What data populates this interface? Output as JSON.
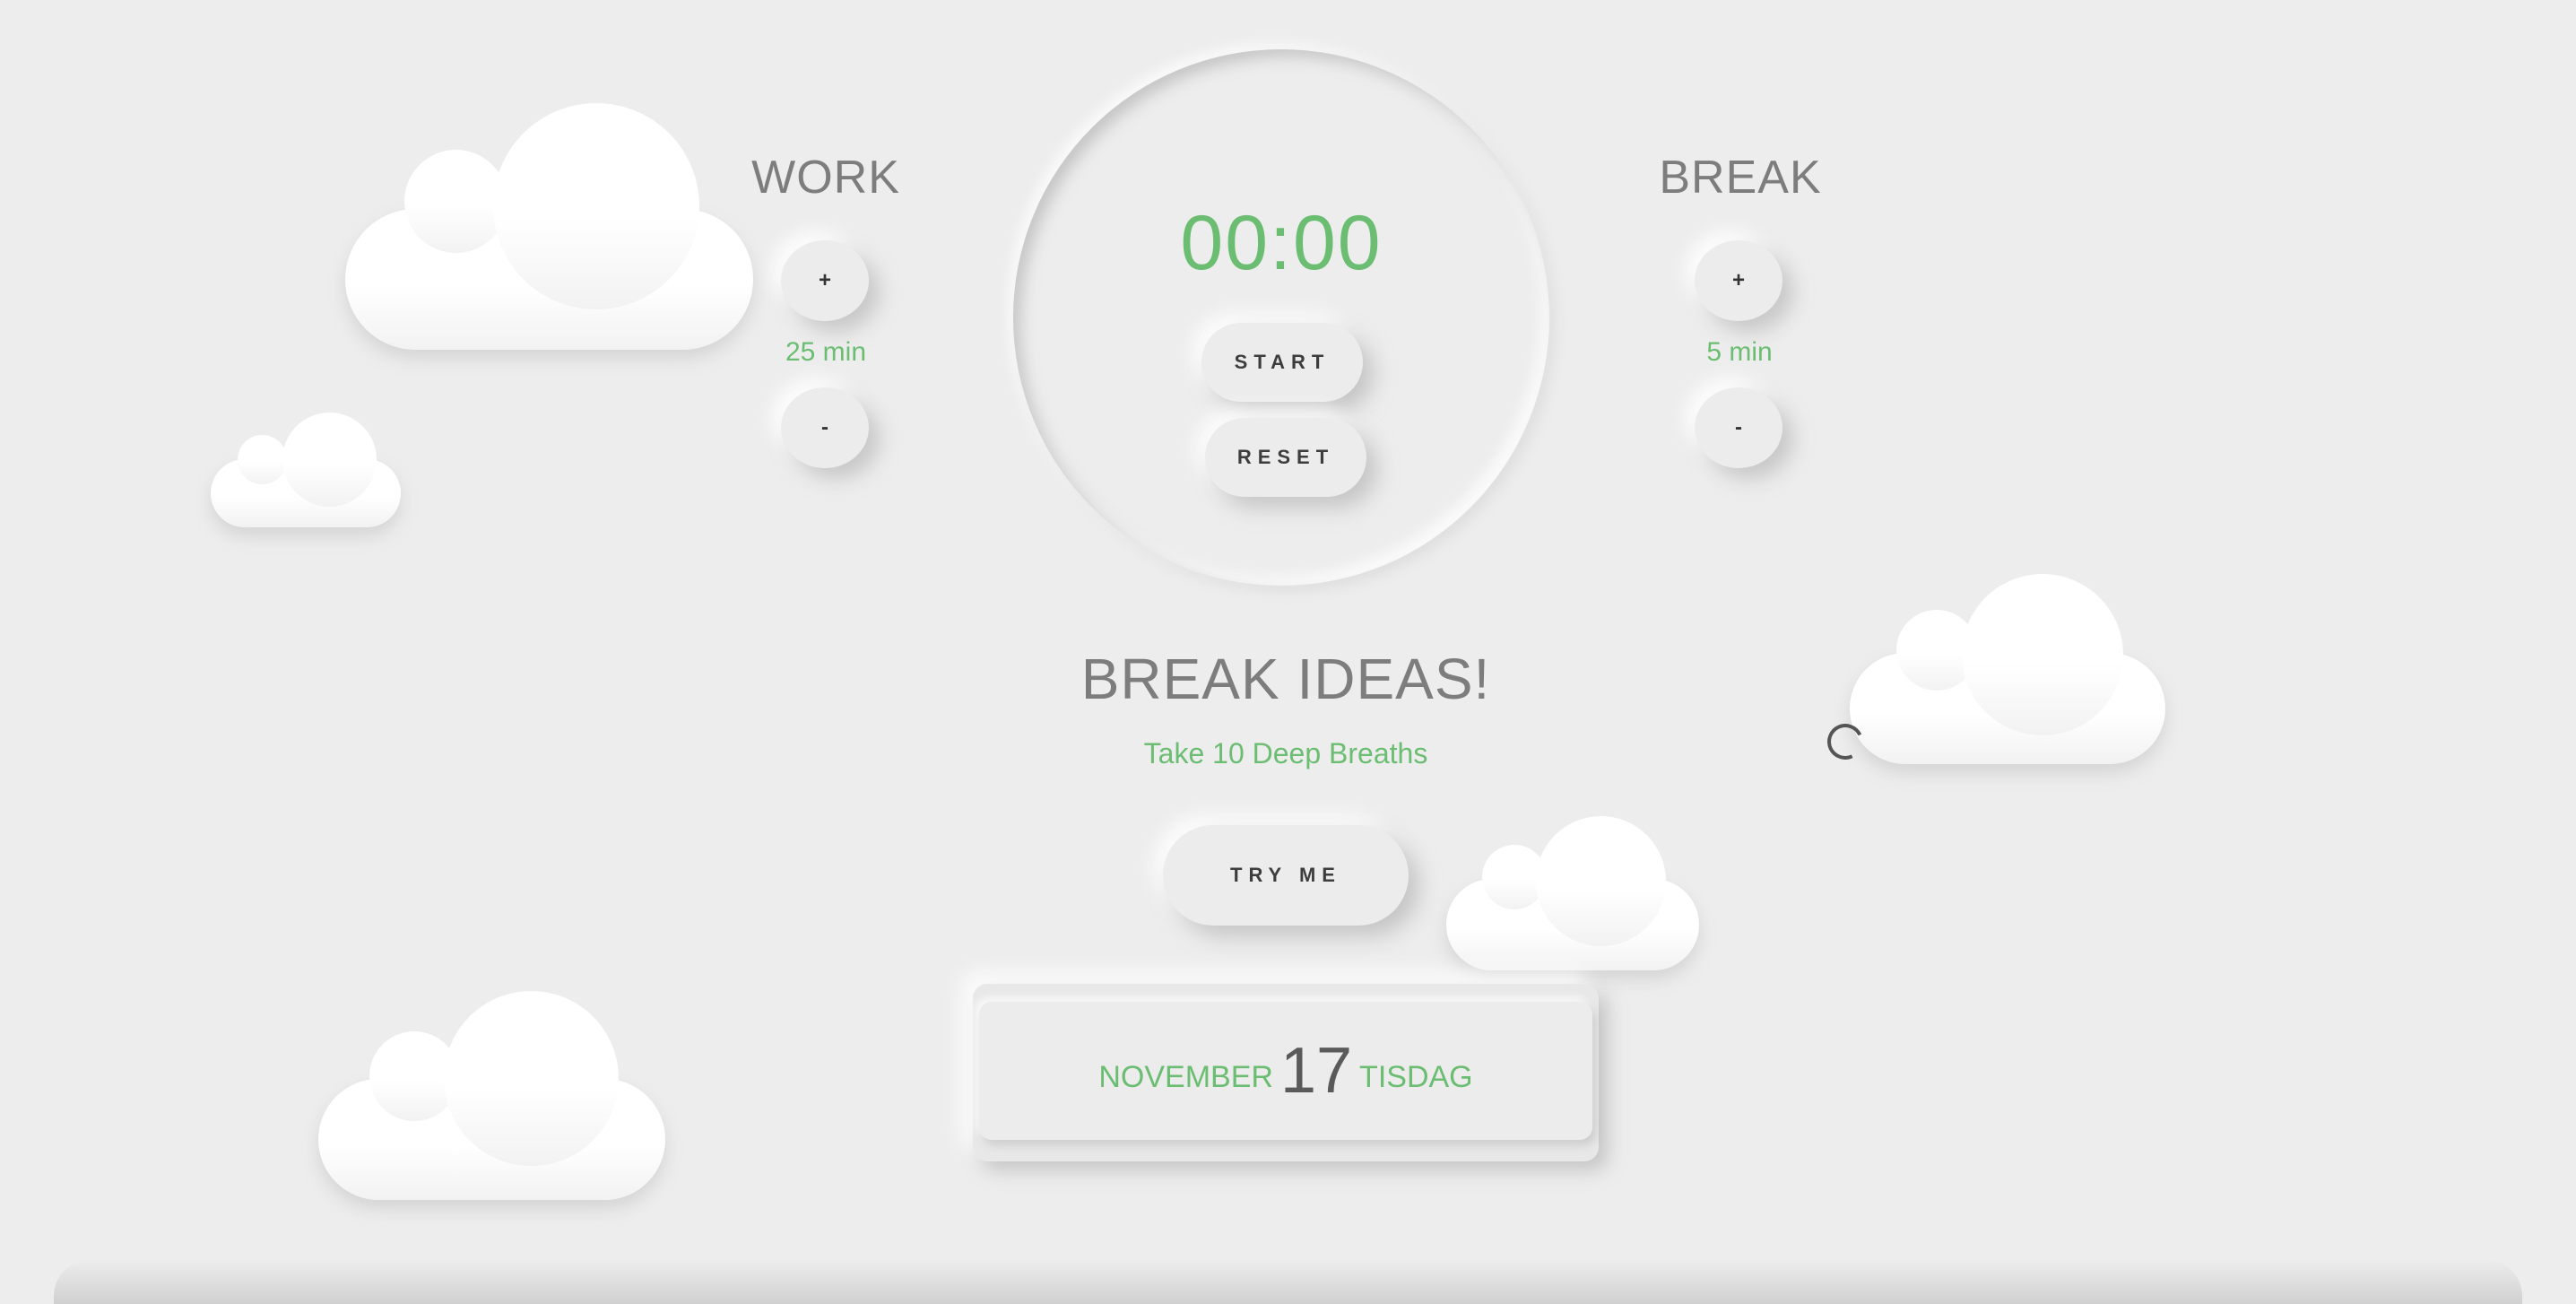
{
  "work": {
    "title": "WORK",
    "plus_label": "+",
    "minus_label": "-",
    "minutes": "25 min"
  },
  "break": {
    "title": "BREAK",
    "plus_label": "+",
    "minus_label": "-",
    "minutes": "5 min"
  },
  "timer": {
    "time": "00:00",
    "start_label": "START",
    "reset_label": "RESET"
  },
  "ideas": {
    "title": "BREAK IDEAS!",
    "text": "Take 10 Deep Breaths",
    "try_label": "TRY ME"
  },
  "date": {
    "month": "NOVEMBER",
    "day": "17",
    "weekday": "TISDAG"
  },
  "colors": {
    "accent": "#6bbd72",
    "background": "#ededed",
    "title_gray": "#7d7d7d"
  },
  "icons": {
    "loader": "loading-ring-icon",
    "clouds": "cloud-icon"
  }
}
